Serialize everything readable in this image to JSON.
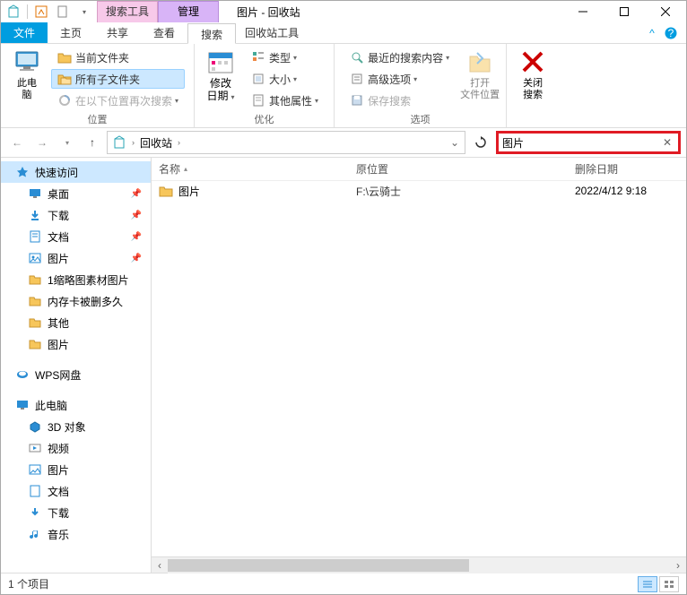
{
  "title": "图片 - 回收站",
  "context_tabs": {
    "search": "搜索工具",
    "manage": "管理"
  },
  "tabs": {
    "file": "文件",
    "home": "主页",
    "share": "共享",
    "view": "查看",
    "search": "搜索",
    "recycle": "回收站工具"
  },
  "ribbon": {
    "group_location": "位置",
    "group_optimize": "优化",
    "group_options": "选项",
    "this_pc": "此电\n脑",
    "current_folder": "当前文件夹",
    "all_subfolders": "所有子文件夹",
    "search_again": "在以下位置再次搜索",
    "modify_date": "修改\n日期",
    "type": "类型",
    "size": "大小",
    "other_props": "其他属性",
    "recent": "最近的搜索内容",
    "advanced": "高级选项",
    "save_search": "保存搜索",
    "open_loc": "打开\n文件位置",
    "close_search": "关闭\n搜索"
  },
  "breadcrumb": {
    "root": "回收站"
  },
  "search": {
    "value": "图片"
  },
  "sidebar": {
    "quick": "快速访问",
    "desktop": "桌面",
    "downloads": "下载",
    "documents": "文档",
    "pictures": "图片",
    "thumb": "1缩略图素材图片",
    "sdcard": "内存卡被删多久",
    "other": "其他",
    "pictures2": "图片",
    "wps": "WPS网盘",
    "thispc": "此电脑",
    "3d": "3D 对象",
    "video": "视频",
    "pictures3": "图片",
    "documents2": "文档",
    "downloads2": "下载",
    "music": "音乐"
  },
  "columns": {
    "name": "名称",
    "orig": "原位置",
    "date": "删除日期"
  },
  "rows": [
    {
      "name": "图片",
      "orig": "F:\\云骑士",
      "date": "2022/4/12 9:18"
    }
  ],
  "status": {
    "count": "1 个项目"
  }
}
